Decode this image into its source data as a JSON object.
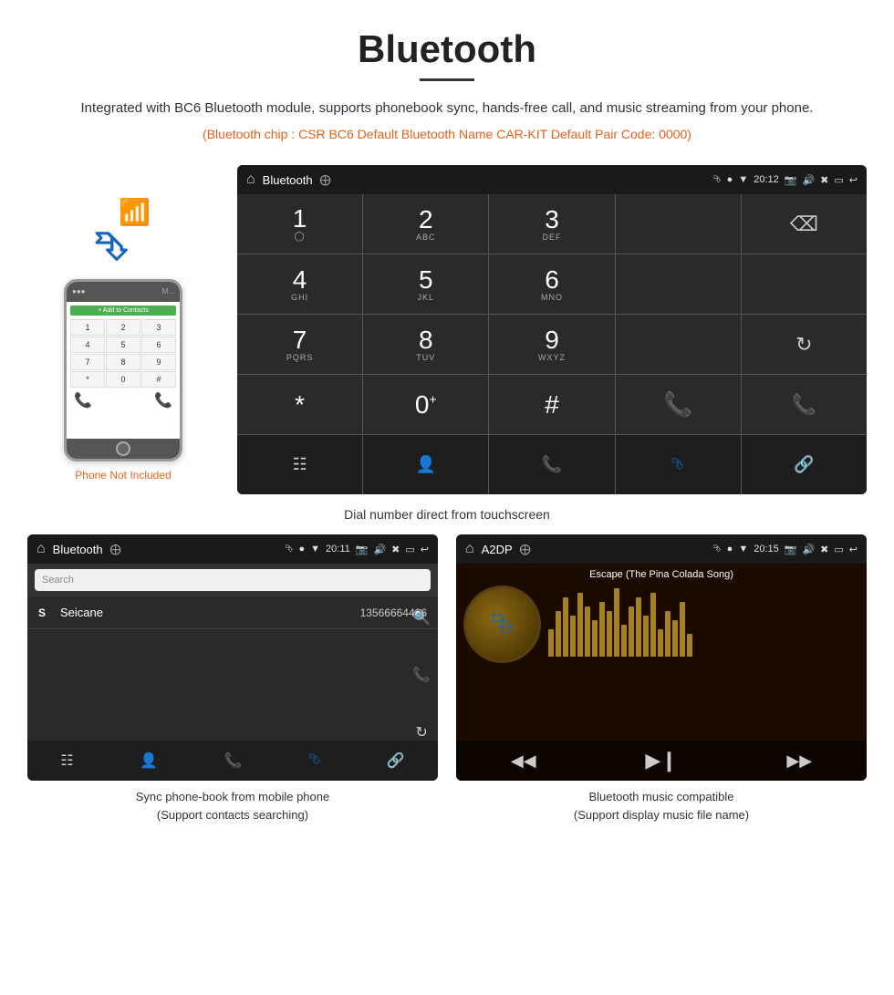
{
  "header": {
    "title": "Bluetooth",
    "divider": true,
    "description": "Integrated with BC6 Bluetooth module, supports phonebook sync, hands-free call, and music streaming from your phone.",
    "specs": "(Bluetooth chip : CSR BC6    Default Bluetooth Name CAR-KIT    Default Pair Code: 0000)"
  },
  "phone": {
    "not_included_label": "Phone Not Included"
  },
  "dialer": {
    "statusbar": {
      "title": "Bluetooth",
      "time": "20:12"
    },
    "keys": [
      {
        "num": "1",
        "sub": ""
      },
      {
        "num": "2",
        "sub": "ABC"
      },
      {
        "num": "3",
        "sub": "DEF"
      },
      {
        "num": "",
        "sub": ""
      },
      {
        "num": "",
        "sub": ""
      },
      {
        "num": "4",
        "sub": "GHI"
      },
      {
        "num": "5",
        "sub": "JKL"
      },
      {
        "num": "6",
        "sub": "MNO"
      },
      {
        "num": "",
        "sub": ""
      },
      {
        "num": "",
        "sub": ""
      },
      {
        "num": "7",
        "sub": "PQRS"
      },
      {
        "num": "8",
        "sub": "TUV"
      },
      {
        "num": "9",
        "sub": "WXYZ"
      },
      {
        "num": "",
        "sub": ""
      },
      {
        "num": "",
        "sub": ""
      },
      {
        "num": "*",
        "sub": ""
      },
      {
        "num": "0",
        "sub": "+"
      },
      {
        "num": "#",
        "sub": ""
      },
      {
        "num": "",
        "sub": ""
      },
      {
        "num": "",
        "sub": ""
      }
    ]
  },
  "dial_caption": "Dial number direct from touchscreen",
  "contacts": {
    "statusbar_title": "Bluetooth",
    "statusbar_time": "20:11",
    "search_placeholder": "Search",
    "contact_name": "Seicane",
    "contact_phone": "13566664466"
  },
  "music": {
    "statusbar_title": "A2DP",
    "statusbar_time": "20:15",
    "song_title": "Escape (The Pina Colada Song)"
  },
  "captions": {
    "contacts": "Sync phone-book from mobile phone\n(Support contacts searching)",
    "music": "Bluetooth music compatible\n(Support display music file name)"
  }
}
